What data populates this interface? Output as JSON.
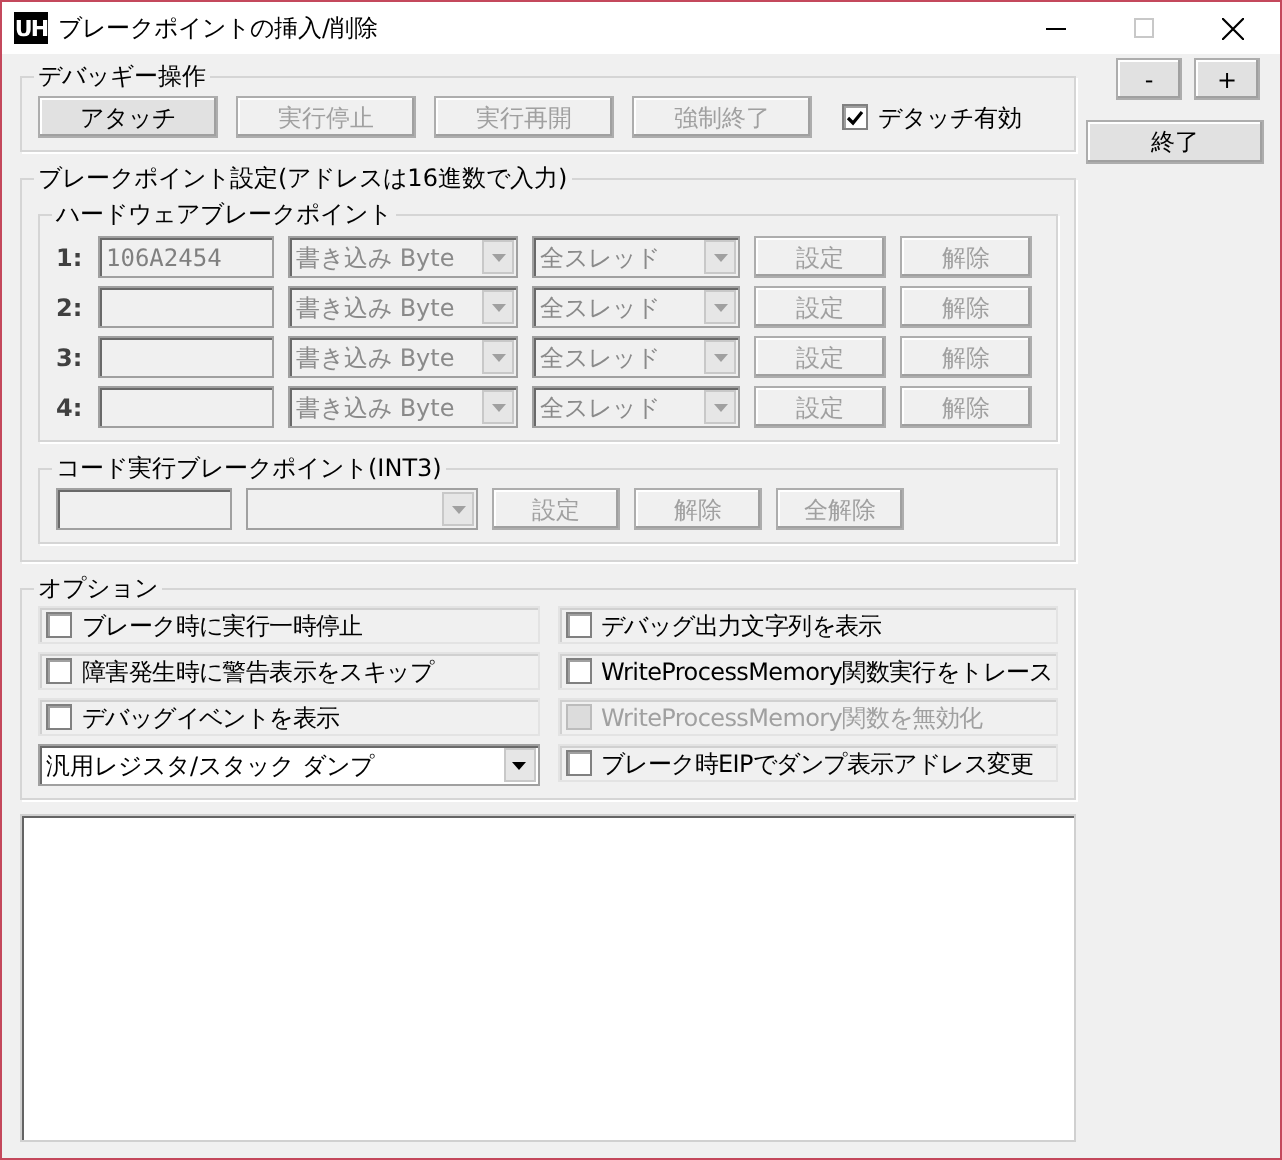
{
  "window": {
    "logo_text": "UH",
    "title": "ブレークポイントの挿入/削除"
  },
  "debuggee": {
    "title": "デバッギー操作",
    "buttons": [
      {
        "label": "アタッチ",
        "disabled": false
      },
      {
        "label": "実行停止",
        "disabled": true
      },
      {
        "label": "実行再開",
        "disabled": true
      },
      {
        "label": "強制終了",
        "disabled": true
      }
    ],
    "detach": {
      "label": "デタッチ有効",
      "checked": true
    }
  },
  "side_buttons": [
    {
      "label": "-"
    },
    {
      "label": "+"
    },
    {
      "label": "終了"
    }
  ],
  "breakpoints": {
    "title": "ブレークポイント設定(アドレスは16進数で入力)",
    "hardware": {
      "title": "ハードウェアブレークポイント",
      "rows": [
        {
          "number": "1:",
          "address": "106A2454",
          "access": "書き込み Byte",
          "thread": "全スレッド",
          "set": "設定",
          "clear": "解除",
          "disabled": true
        },
        {
          "number": "2:",
          "access": "書き込み Byte",
          "thread": "全スレッド",
          "set": "設定",
          "clear": "解除",
          "disabled": true
        },
        {
          "number": "3:",
          "access": "書き込み Byte",
          "thread": "全スレッド",
          "set": "設定",
          "clear": "解除",
          "disabled": true
        },
        {
          "number": "4:",
          "access": "書き込み Byte",
          "thread": "全スレッド",
          "set": "設定",
          "clear": "解除",
          "disabled": true
        }
      ]
    },
    "code": {
      "title": "コード実行ブレークポイント(INT3)",
      "disabled": true,
      "buttons": [
        "設定",
        "解除",
        "全解除"
      ]
    }
  },
  "options": {
    "title": "オプション",
    "items": [
      {
        "kind": "checkbox",
        "label": "ブレーク時に実行一時停止",
        "checked": false,
        "disabled": false
      },
      {
        "kind": "checkbox",
        "label": "デバッグ出力文字列を表示",
        "checked": false,
        "disabled": false
      },
      {
        "kind": "checkbox",
        "label": "障害発生時に警告表示をスキップ",
        "checked": false,
        "disabled": false
      },
      {
        "kind": "checkbox",
        "label": "WriteProcessMemory関数実行をトレース",
        "checked": false,
        "disabled": false
      },
      {
        "kind": "checkbox",
        "label": "デバッグイベントを表示",
        "checked": false,
        "disabled": false
      },
      {
        "kind": "checkbox",
        "label": "WriteProcessMemory関数を無効化",
        "checked": false,
        "disabled": true
      },
      {
        "kind": "dropdown",
        "value": "汎用レジスタ/スタック ダンプ"
      },
      {
        "kind": "checkbox",
        "label": "ブレーク時EIPでダンプ表示アドレス変更",
        "checked": false,
        "disabled": false
      }
    ]
  }
}
